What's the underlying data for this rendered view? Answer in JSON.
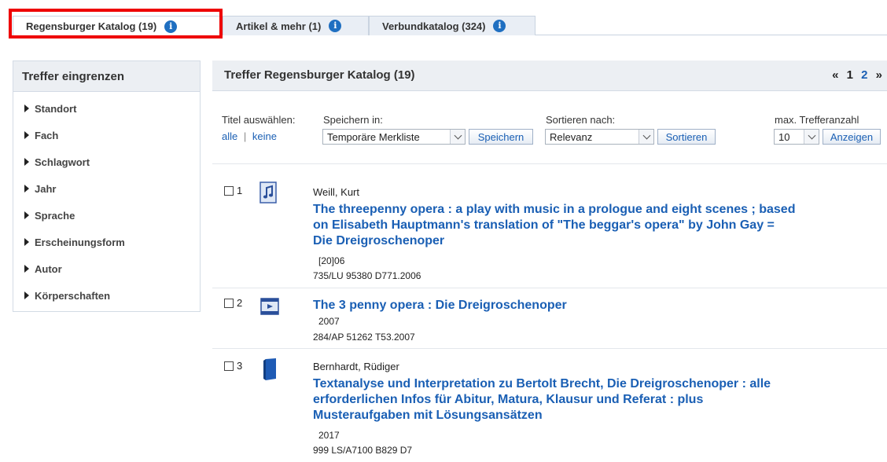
{
  "tabs": [
    {
      "label": "Regensburger Katalog (19)"
    },
    {
      "label": "Artikel & mehr (1)"
    },
    {
      "label": "Verbundkatalog (324)"
    }
  ],
  "sidebar": {
    "title": "Treffer eingrenzen",
    "facets": [
      "Standort",
      "Fach",
      "Schlagwort",
      "Jahr",
      "Sprache",
      "Erscheinungsform",
      "Autor",
      "Körperschaften"
    ]
  },
  "main": {
    "title": "Treffer Regensburger Katalog (19)",
    "pager": {
      "prev": "«",
      "current": "1",
      "next_page": "2",
      "next": "»"
    }
  },
  "controls": {
    "select_label": "Titel auswählen:",
    "select_all": "alle",
    "select_divider": "|",
    "select_none": "keine",
    "save_label": "Speichern in:",
    "save_value": "Temporäre Merkliste",
    "save_button": "Speichern",
    "sort_label": "Sortieren nach:",
    "sort_value": "Relevanz",
    "sort_button": "Sortieren",
    "max_label": "max. Trefferanzahl",
    "max_value": "10",
    "max_button": "Anzeigen"
  },
  "results": [
    {
      "number": "1",
      "icon": "music-score-icon",
      "author": "Weill, Kurt",
      "title_lines": [
        "The threepenny opera : a play with music in a prologue and eight scenes ; based",
        "on Elisabeth Hauptmann's translation of \"The beggar's opera\" by John Gay =",
        "Die Dreigroschenoper"
      ],
      "year": "[20]06",
      "signature": "735/LU 95380 D771.2006"
    },
    {
      "number": "2",
      "icon": "video-icon",
      "title_lines": [
        "The 3 penny opera : Die Dreigroschenoper"
      ],
      "year": "2007",
      "signature": "284/AP 51262 T53.2007"
    },
    {
      "number": "3",
      "icon": "book-icon",
      "author": "Bernhardt, Rüdiger",
      "title_lines": [
        "Textanalyse und Interpretation zu Bertolt Brecht, Die Dreigroschenoper : alle",
        "erforderlichen Infos für Abitur, Matura, Klausur und Referat : plus",
        "Musteraufgaben mit Lösungsansätzen"
      ],
      "year": "2017",
      "signature": "999 LS/A7100 B829 D7"
    }
  ],
  "colors": {
    "link": "#1a5fb4",
    "info_icon": "#1f6fc1",
    "highlight": "#ee0000",
    "header_bg": "#eceff3"
  }
}
